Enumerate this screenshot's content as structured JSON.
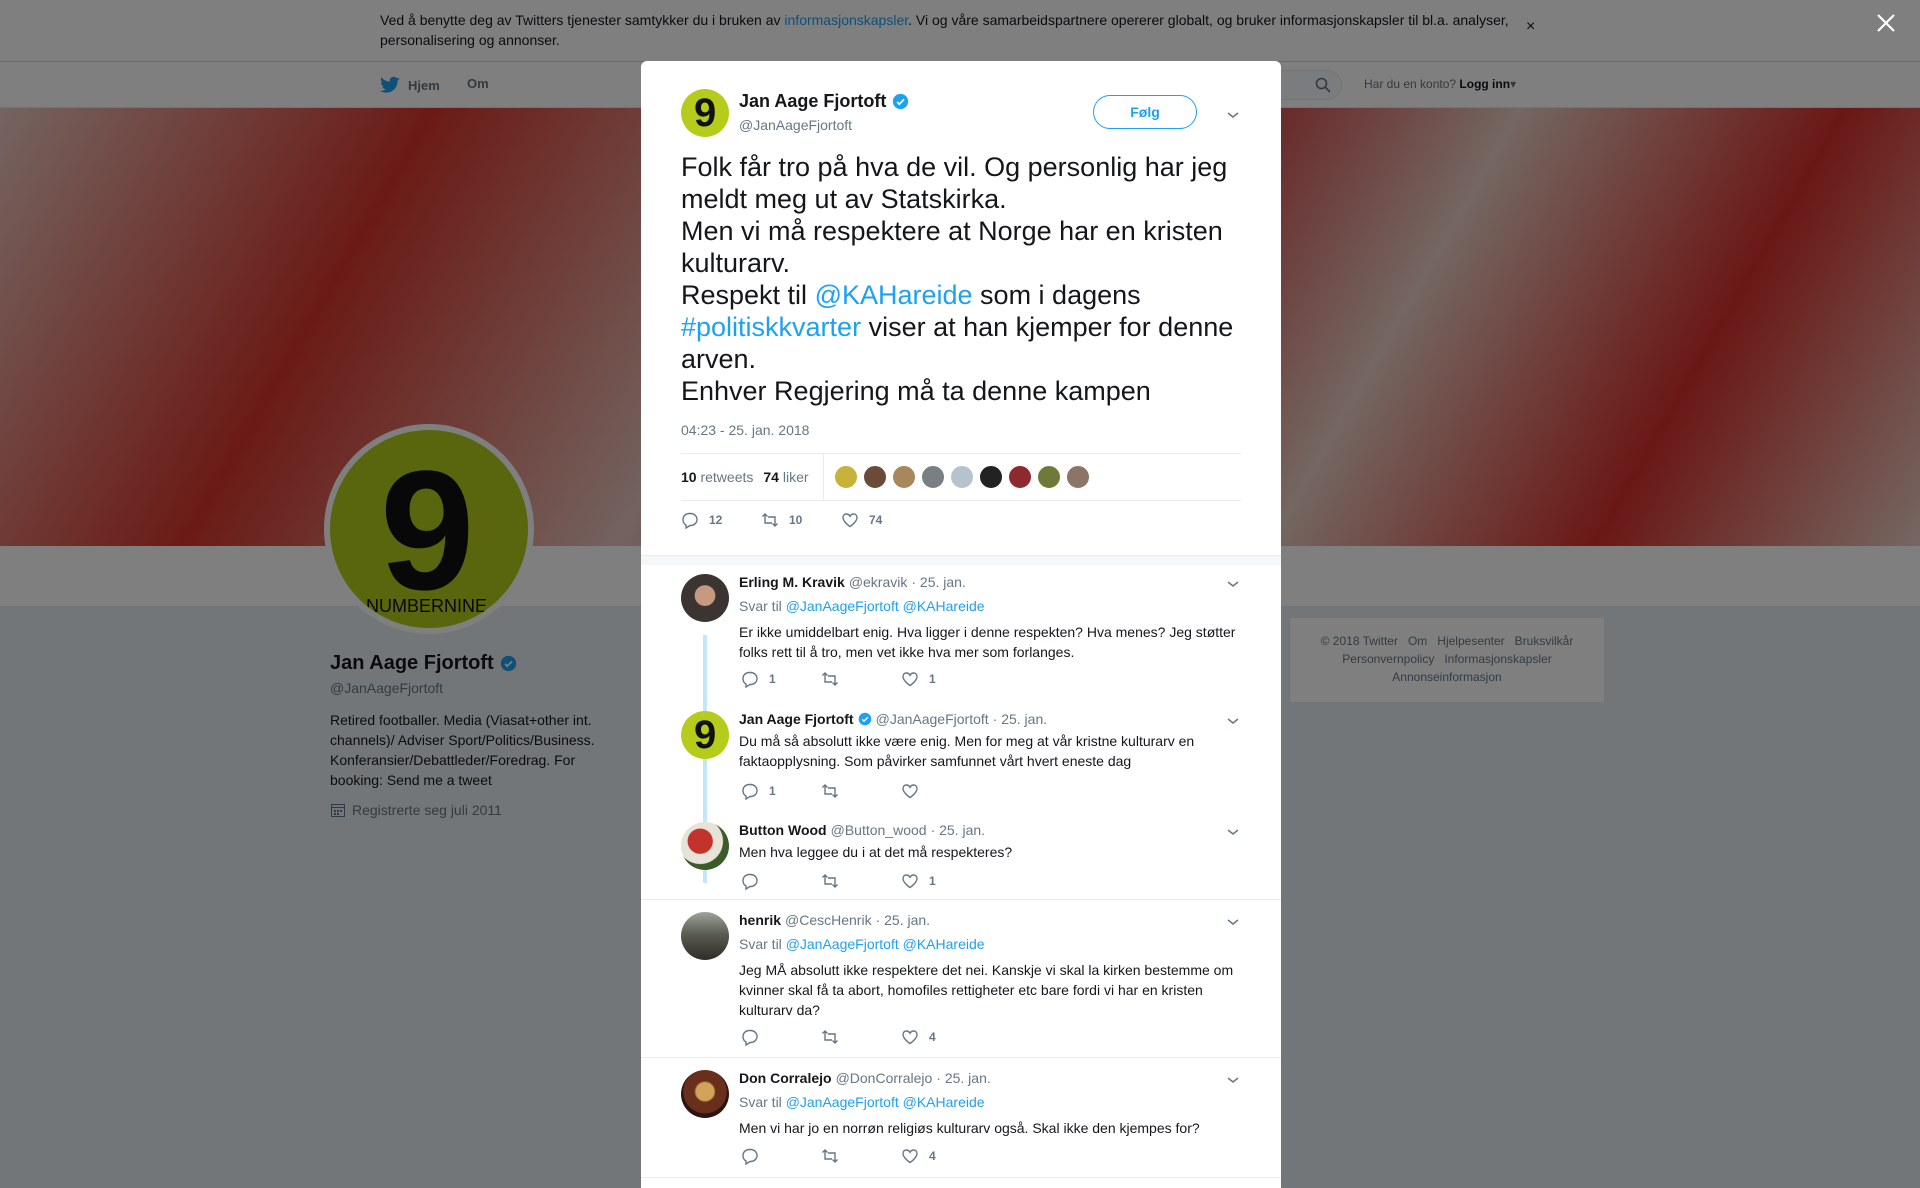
{
  "cookie": {
    "text_before": "Ved å benytte deg av Twitters tjenester samtykker du i bruken av ",
    "link": "informasjonskapsler",
    "text_after": ". Vi og våre samarbeidspartnere opererer globalt, og bruker informasjonskapsler til bl.a. analyser, personalisering og annonser.",
    "close": "×"
  },
  "nav": {
    "home": "Hjem",
    "about": "Om",
    "login_prompt": "Har du en konto?",
    "login": "Logg inn"
  },
  "profile": {
    "name": "Jan Aage Fjortoft",
    "handle": "@JanAageFjortoft",
    "bio": "Retired footballer. Media (Viasat+other int. channels)/ Adviser Sport/Politics/Business. Konferansier/Debattleder/Foredrag. For booking: Send me a tweet",
    "joined": "Registrerte seg juli 2011",
    "logo_text": "NUMBERNINE."
  },
  "footer": [
    "© 2018 Twitter",
    "Om",
    "Hjelpesenter",
    "Bruksvilkår",
    "Personvernpolicy",
    "Informasjonskapsler",
    "Annonseinformasjon"
  ],
  "tweet": {
    "name": "Jan Aage Fjortoft",
    "handle": "@JanAageFjortoft",
    "follow": "Følg",
    "line1": "Folk får tro på hva de vil. Og personlig har jeg meldt meg ut av Statskirka.",
    "line2": "Men vi må respektere at Norge har en kristen kulturarv.",
    "line3_a": "Respekt til ",
    "line3_mention": "@KAHareide",
    "line3_b": " som i dagens ",
    "line3_hashtag": "#politiskkvarter",
    "line3_c": " viser at han kjemper for denne arven.",
    "line4": "Enhver Regjering må ta denne kampen",
    "time": "04:23 - 25. jan. 2018",
    "retweets_count": "10",
    "retweets_label": "retweets",
    "likes_count": "74",
    "likes_label": "liker",
    "action_reply": "12",
    "action_retweet": "10",
    "action_like": "74"
  },
  "replies": [
    {
      "name": "Erling M. Kravik",
      "handle": "@ekravik",
      "date": "· 25. jan.",
      "reply_to": "Svar til",
      "to1": "@JanAageFjortoft",
      "to2": "@KAHareide",
      "body": "Er ikke umiddelbart enig. Hva ligger i denne respekten? Hva menes? Jeg støtter folks rett til å tro, men vet ikke hva mer som forlanges.",
      "replies": "1",
      "retweets": "",
      "likes": "1"
    },
    {
      "name": "Jan Aage Fjortoft",
      "handle": "@JanAageFjortoft",
      "date": "· 25. jan.",
      "body": "Du må så absolutt ikke være enig. Men for meg at vår kristne kulturarv en faktaopplysning. Som påvirker samfunnet vårt hvert eneste dag",
      "replies": "1",
      "retweets": "",
      "likes": ""
    },
    {
      "name": "Button Wood",
      "handle": "@Button_wood",
      "date": "· 25. jan.",
      "body": "Men hva leggee du i at det må respekteres?",
      "replies": "",
      "retweets": "",
      "likes": "1"
    },
    {
      "name": "henrik",
      "handle": "@CescHenrik",
      "date": "· 25. jan.",
      "reply_to": "Svar til",
      "to1": "@JanAageFjortoft",
      "to2": "@KAHareide",
      "body": "Jeg MÅ absolutt ikke respektere det nei. Kanskje vi skal la kirken bestemme om kvinner skal få ta abort, homofiles rettigheter etc bare fordi vi har en kristen kulturarv da?",
      "replies": "",
      "retweets": "",
      "likes": "4"
    },
    {
      "name": "Don Corralejo",
      "handle": "@DonCorralejo",
      "date": "· 25. jan.",
      "reply_to": "Svar til",
      "to1": "@JanAageFjortoft",
      "to2": "@KAHareide",
      "body": "Men vi har jo en norrøn religiøs kulturarv også. Skal ikke den kjempes for?",
      "replies": "",
      "retweets": "",
      "likes": "4"
    }
  ],
  "colors": {
    "accent": "#1da1f2",
    "logo_green": "#b5cc1a",
    "banner_red": "#d7362c"
  }
}
